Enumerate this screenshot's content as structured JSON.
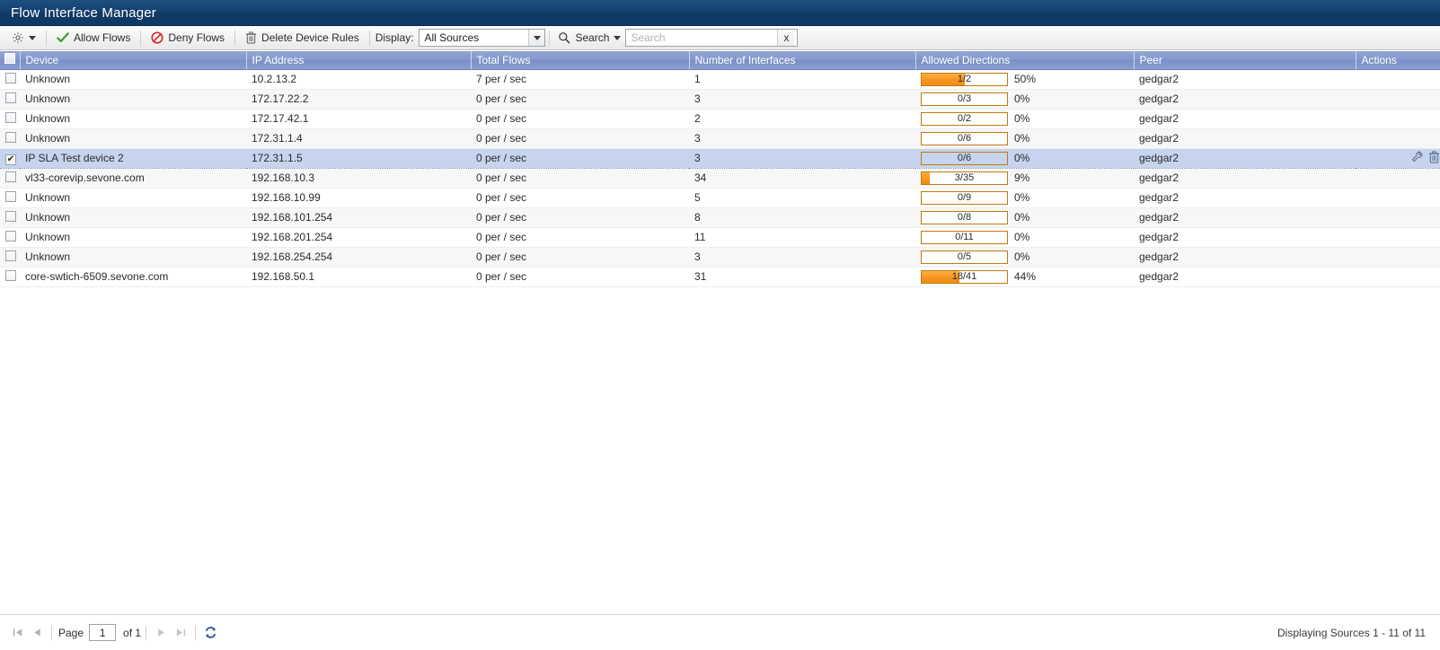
{
  "window": {
    "title": "Flow Interface Manager"
  },
  "toolbar": {
    "settings_icon": "gear-icon",
    "settings_caret": "chevron-down-icon",
    "allow_flows_label": "Allow Flows",
    "allow_flows_icon": "green-check-icon",
    "deny_flows_label": "Deny Flows",
    "deny_flows_icon": "no-entry-icon",
    "delete_device_rules_label": "Delete Device Rules",
    "delete_device_rules_icon": "trash-icon",
    "display_label": "Display:",
    "display_value": "All Sources",
    "display_options": [
      "All Sources"
    ],
    "display_caret": "chevron-down-icon",
    "search_button_label": "Search",
    "search_button_icon": "magnifier-icon",
    "search_button_caret": "chevron-down-icon",
    "search_placeholder": "Search",
    "search_value": "",
    "search_clear_label": "x",
    "search_clear_icon": "close-icon"
  },
  "grid": {
    "select_all_checked": false,
    "columns": [
      "Device",
      "IP Address",
      "Total Flows",
      "Number of Interfaces",
      "Allowed Directions",
      "Peer",
      "Actions"
    ],
    "rows": [
      {
        "checked": false,
        "selected": false,
        "device": "Unknown",
        "ip": "10.2.13.2",
        "flows": "7 per / sec",
        "interfaces": "1",
        "bar_text": "1/2",
        "bar_pct": "50%",
        "bar_fill": 50,
        "peer": "gedgar2",
        "actions": []
      },
      {
        "checked": false,
        "selected": false,
        "device": "Unknown",
        "ip": "172.17.22.2",
        "flows": "0 per / sec",
        "interfaces": "3",
        "bar_text": "0/3",
        "bar_pct": "0%",
        "bar_fill": 0,
        "peer": "gedgar2",
        "actions": []
      },
      {
        "checked": false,
        "selected": false,
        "device": "Unknown",
        "ip": "172.17.42.1",
        "flows": "0 per / sec",
        "interfaces": "2",
        "bar_text": "0/2",
        "bar_pct": "0%",
        "bar_fill": 0,
        "peer": "gedgar2",
        "actions": []
      },
      {
        "checked": false,
        "selected": false,
        "device": "Unknown",
        "ip": "172.31.1.4",
        "flows": "0 per / sec",
        "interfaces": "3",
        "bar_text": "0/6",
        "bar_pct": "0%",
        "bar_fill": 0,
        "peer": "gedgar2",
        "actions": []
      },
      {
        "checked": true,
        "selected": true,
        "device": "IP SLA Test device 2",
        "ip": "172.31.1.5",
        "flows": "0 per / sec",
        "interfaces": "3",
        "bar_text": "0/6",
        "bar_pct": "0%",
        "bar_fill": 0,
        "peer": "gedgar2",
        "actions": [
          "wrench-icon",
          "trash-icon"
        ]
      },
      {
        "checked": false,
        "selected": false,
        "device": "vl33-corevip.sevone.com",
        "ip": "192.168.10.3",
        "flows": "0 per / sec",
        "interfaces": "34",
        "bar_text": "3/35",
        "bar_pct": "9%",
        "bar_fill": 9,
        "peer": "gedgar2",
        "actions": []
      },
      {
        "checked": false,
        "selected": false,
        "device": "Unknown",
        "ip": "192.168.10.99",
        "flows": "0 per / sec",
        "interfaces": "5",
        "bar_text": "0/9",
        "bar_pct": "0%",
        "bar_fill": 0,
        "peer": "gedgar2",
        "actions": []
      },
      {
        "checked": false,
        "selected": false,
        "device": "Unknown",
        "ip": "192.168.101.254",
        "flows": "0 per / sec",
        "interfaces": "8",
        "bar_text": "0/8",
        "bar_pct": "0%",
        "bar_fill": 0,
        "peer": "gedgar2",
        "actions": []
      },
      {
        "checked": false,
        "selected": false,
        "device": "Unknown",
        "ip": "192.168.201.254",
        "flows": "0 per / sec",
        "interfaces": "11",
        "bar_text": "0/11",
        "bar_pct": "0%",
        "bar_fill": 0,
        "peer": "gedgar2",
        "actions": []
      },
      {
        "checked": false,
        "selected": false,
        "device": "Unknown",
        "ip": "192.168.254.254",
        "flows": "0 per / sec",
        "interfaces": "3",
        "bar_text": "0/5",
        "bar_pct": "0%",
        "bar_fill": 0,
        "peer": "gedgar2",
        "actions": []
      },
      {
        "checked": false,
        "selected": false,
        "device": "core-swtich-6509.sevone.com",
        "ip": "192.168.50.1",
        "flows": "0 per / sec",
        "interfaces": "31",
        "bar_text": "18/41",
        "bar_pct": "44%",
        "bar_fill": 44,
        "peer": "gedgar2",
        "actions": []
      }
    ]
  },
  "footer": {
    "first_icon": "first-page-icon",
    "prev_icon": "prev-page-icon",
    "page_label": "Page",
    "page_value": "1",
    "of_label": "of 1",
    "next_icon": "next-page-icon",
    "last_icon": "last-page-icon",
    "refresh_icon": "refresh-icon",
    "status": "Displaying Sources 1 - 11 of 11"
  },
  "colors": {
    "title_bg": "#13406e",
    "header_bg": "#8599cc",
    "bar_border": "#c07a12",
    "bar_fill": "#f79421",
    "selection_bg": "#c6d4ed"
  }
}
